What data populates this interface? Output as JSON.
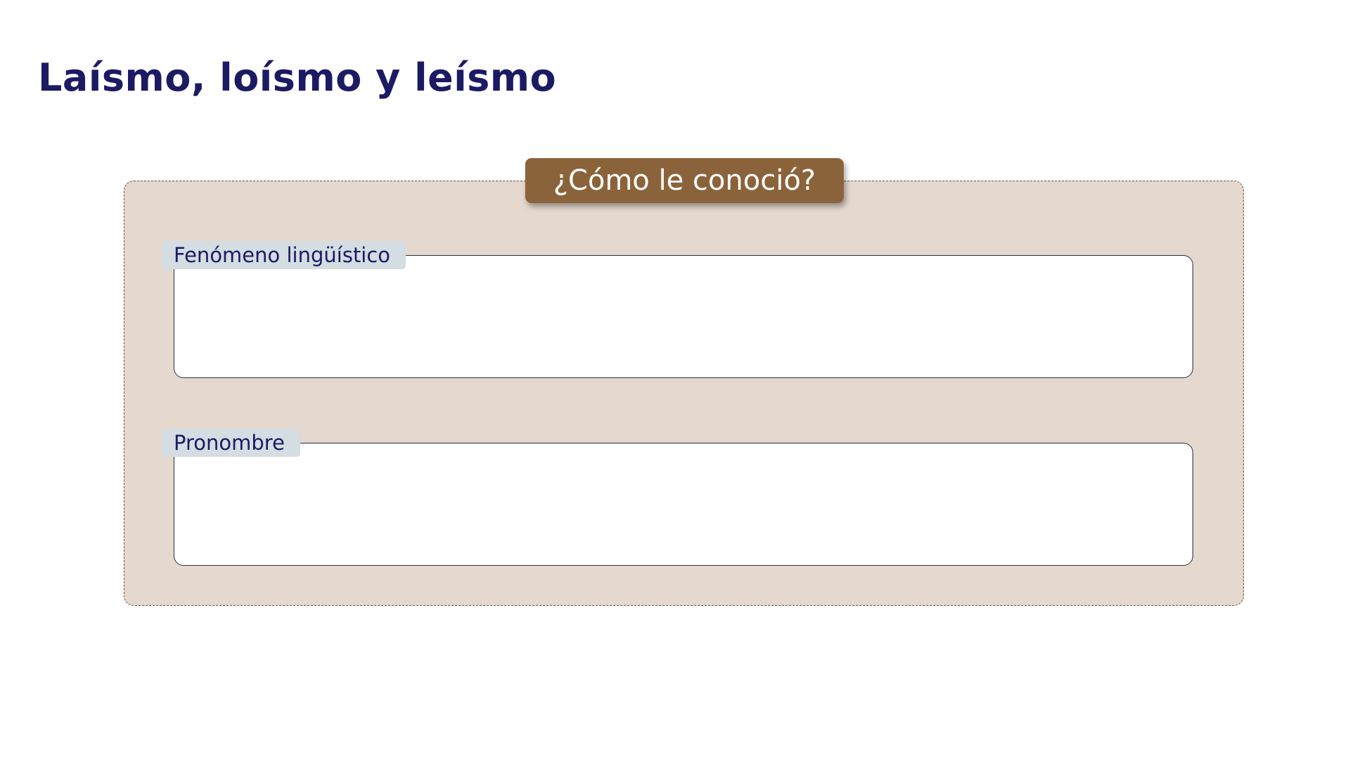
{
  "slide": {
    "title": "Laísmo, loísmo y leísmo"
  },
  "question": {
    "label": "¿Cómo le conoció?"
  },
  "fields": [
    {
      "label": "Fenómeno lingüístico",
      "value": ""
    },
    {
      "label": "Pronombre",
      "value": ""
    }
  ],
  "colors": {
    "title": "#1c1a63",
    "panel_background": "#e4d8cf",
    "panel_border": "#7a4a3a",
    "question_tab": "#8b633a",
    "field_label_background": "#d3dde2"
  }
}
